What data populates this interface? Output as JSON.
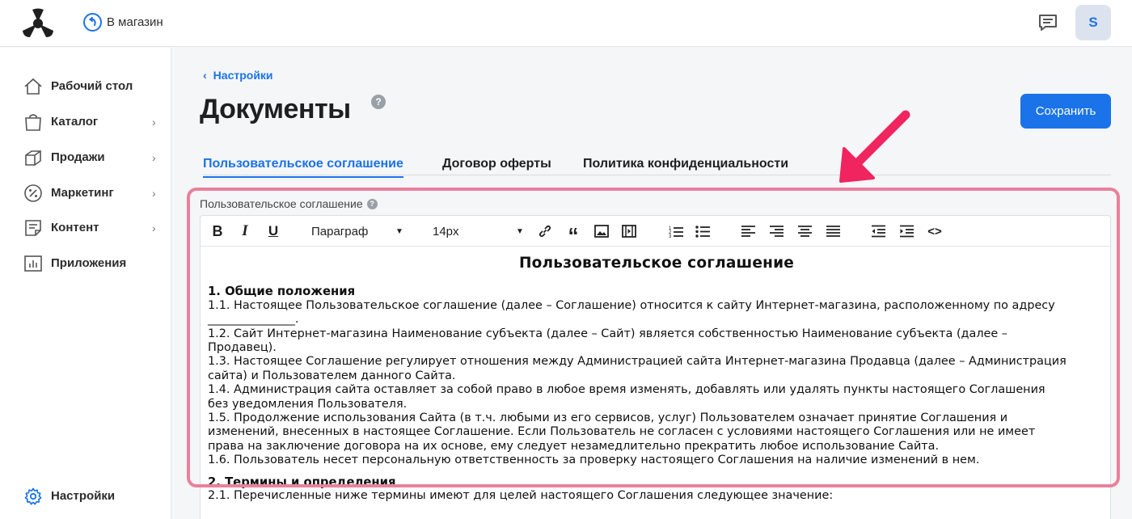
{
  "header": {
    "back_to_store": "В магазин",
    "avatar_initial": "S"
  },
  "sidebar": {
    "items": [
      {
        "label": "Рабочий стол",
        "icon": "home-icon",
        "has_chevron": false
      },
      {
        "label": "Каталог",
        "icon": "shopping-bag-icon",
        "has_chevron": true
      },
      {
        "label": "Продажи",
        "icon": "sales-icon",
        "has_chevron": true
      },
      {
        "label": "Маркетинг",
        "icon": "percent-icon",
        "has_chevron": true
      },
      {
        "label": "Контент",
        "icon": "document-icon",
        "has_chevron": true
      },
      {
        "label": "Приложения",
        "icon": "bar-chart-icon",
        "has_chevron": false
      }
    ],
    "settings_label": "Настройки"
  },
  "breadcrumb": {
    "label": "Настройки"
  },
  "page": {
    "title": "Документы",
    "save_label": "Сохранить"
  },
  "tabs": [
    {
      "label": "Пользовательское соглашение",
      "active": true
    },
    {
      "label": "Договор оферты",
      "active": false
    },
    {
      "label": "Политика конфиденциальности",
      "active": false
    }
  ],
  "editor": {
    "field_label": "Пользовательское соглашение",
    "toolbar": {
      "paragraph_select": "Параграф",
      "font_size_select": "14px"
    },
    "document": {
      "title": "Пользовательское соглашение",
      "section1_heading": "1. Общие положения",
      "section1_lines": [
        "1.1. Настоящее Пользовательское соглашение (далее – Соглашение) относится к сайту Интернет-магазина, расположенному по адресу",
        "_______________.",
        "1.2. Сайт Интернет-магазина Наименование субъекта (далее – Сайт) является собственностью Наименование субъекта (далее –",
        "Продавец).",
        "1.3. Настоящее Соглашение регулирует отношения между Администрацией сайта Интернет-магазина Продавца (далее – Администрация",
        "сайта) и Пользователем данного Сайта.",
        "1.4. Администрация сайта оставляет за собой право в любое время изменять, добавлять или удалять пункты настоящего Соглашения",
        "без уведомления Пользователя.",
        "1.5. Продолжение использования Сайта (в т.ч. любыми из его сервисов, услуг) Пользователем означает принятие Соглашения и",
        "изменений, внесенных в настоящее Соглашение. Если Пользователь не согласен с условиями настоящего Соглашения или не имеет",
        "права на заключение договора на их основе, ему следует незамедлительно прекратить любое использование Сайта.",
        "1.6. Пользователь несет персональную ответственность за проверку настоящего Соглашения на наличие изменений в нем."
      ],
      "section2_heading": "2. Термины и определения",
      "section2_first_line": "2.1. Перечисленные ниже термины имеют для целей настоящего Соглашения следующее значение:"
    }
  },
  "colors": {
    "accent": "#1a73e8",
    "highlight": "#e9819c",
    "arrow": "#f0245e"
  }
}
